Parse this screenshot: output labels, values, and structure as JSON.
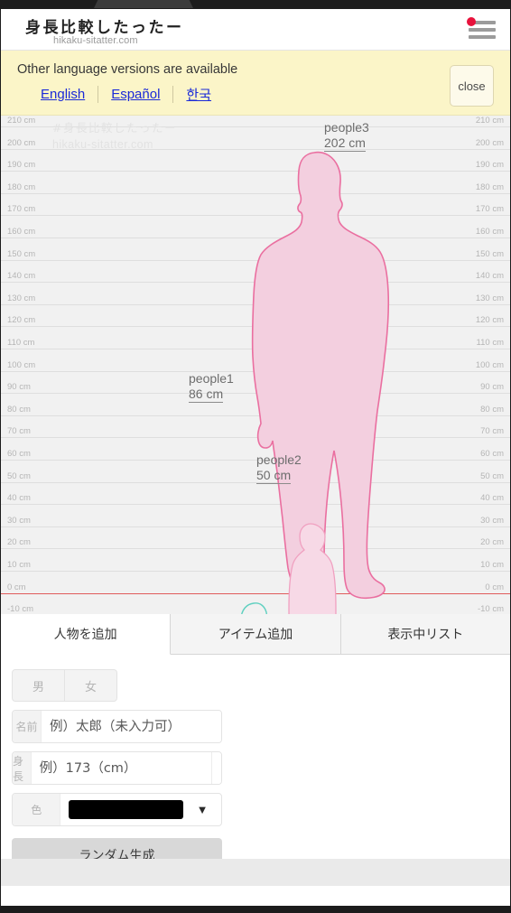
{
  "header": {
    "title": "身長比較したったー",
    "subtitle": "hikaku-sitatter.com",
    "menu_icon": "hamburger-menu-icon",
    "badge_color": "#e8123c"
  },
  "language_banner": {
    "message": "Other language versions are available",
    "links": [
      "English",
      "Español",
      "한국"
    ],
    "close_label": "close"
  },
  "canvas": {
    "watermark_line1": "#身長比較したったー",
    "watermark_line2": "hikaku-sitatter.com",
    "ticks": [
      "210 cm",
      "200 cm",
      "190 cm",
      "180 cm",
      "170 cm",
      "160 cm",
      "150 cm",
      "140 cm",
      "130 cm",
      "120 cm",
      "110 cm",
      "100 cm",
      "90 cm",
      "80 cm",
      "70 cm",
      "60 cm",
      "50 cm",
      "40 cm",
      "30 cm",
      "20 cm",
      "10 cm",
      "0 cm",
      "-10 cm"
    ],
    "zero_line_color": "#e05b5b",
    "figures": [
      {
        "name": "people1",
        "height": "86 cm",
        "height_cm": 86,
        "color": "#f0a0c0"
      },
      {
        "name": "people2",
        "height": "50 cm",
        "height_cm": 50,
        "color": "#5fd0c0"
      },
      {
        "name": "people3",
        "height": "202 cm",
        "height_cm": 202,
        "fill": "#f3cfdf",
        "stroke": "#ea6fa0"
      }
    ]
  },
  "tabs": [
    {
      "label": "人物を追加",
      "active": true
    },
    {
      "label": "アイテム追加",
      "active": false
    },
    {
      "label": "表示中リスト",
      "active": false
    }
  ],
  "form": {
    "gender": {
      "male": "男",
      "female": "女"
    },
    "name_field": {
      "label": "名前",
      "placeholder": "例）太郎（未入力可）",
      "value": ""
    },
    "height_field": {
      "label": "身長",
      "placeholder": "例）173（cm）",
      "value": ""
    },
    "color_field": {
      "label": "色",
      "swatch": "#000000",
      "caret": "▼"
    },
    "random_button": "ランダム生成"
  }
}
